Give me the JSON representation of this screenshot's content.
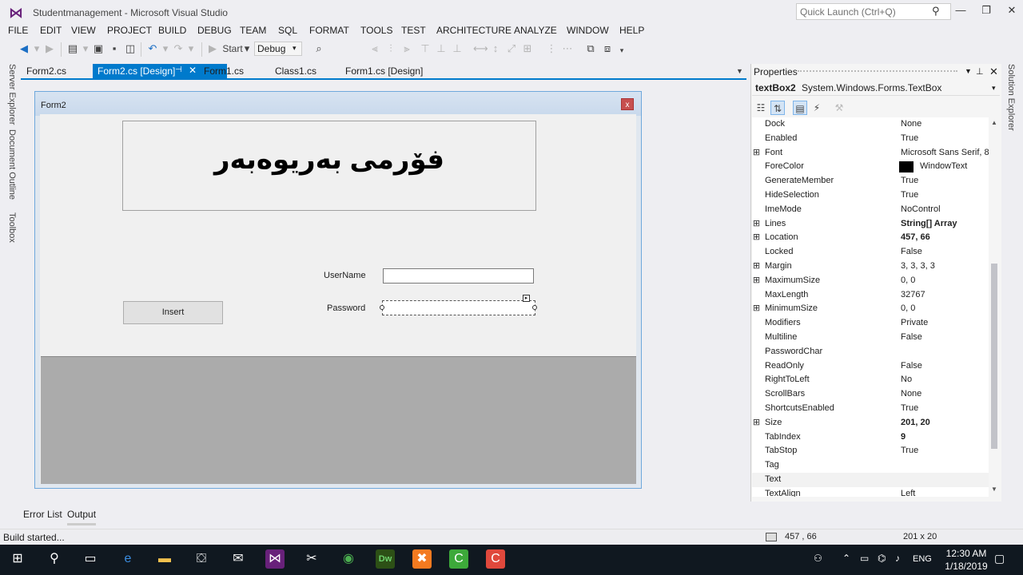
{
  "window": {
    "title": "Studentmanagement - Microsoft Visual Studio",
    "quick_launch_placeholder": "Quick Launch (Ctrl+Q)",
    "minimize": "—",
    "restore": "❐",
    "close": "✕"
  },
  "menu": [
    "FILE",
    "EDIT",
    "VIEW",
    "PROJECT",
    "BUILD",
    "DEBUG",
    "TEAM",
    "SQL",
    "FORMAT",
    "TOOLS",
    "TEST",
    "ARCHITECTURE",
    "ANALYZE",
    "WINDOW",
    "HELP"
  ],
  "toolbar": {
    "start_label": "Start",
    "config_value": "Debug"
  },
  "side_tabs": {
    "server_explorer": "Server Explorer",
    "document_outline": "Document Outline",
    "toolbox": "Toolbox",
    "solution_explorer": "Solution Explorer"
  },
  "doc_tabs": [
    "Form2.cs",
    "Form2.cs [Design]",
    "Form1.cs",
    "Class1.cs",
    "Form1.cs [Design]"
  ],
  "form": {
    "title": "Form2",
    "close_glyph": "x",
    "header_text": "فۆرمی بەریوەبەر",
    "username_label": "UserName",
    "password_label": "Password",
    "insert_label": "Insert"
  },
  "bottom_tabs": [
    "Error List",
    "Output"
  ],
  "properties": {
    "title": "Properties",
    "object_name": "textBox2",
    "object_type": "System.Windows.Forms.TextBox",
    "rows": [
      {
        "name": "Dock",
        "value": "None",
        "expandable": false,
        "bold": false
      },
      {
        "name": "Enabled",
        "value": "True",
        "expandable": false,
        "bold": false
      },
      {
        "name": "Font",
        "value": "Microsoft Sans Serif, 8",
        "expandable": true,
        "bold": false
      },
      {
        "name": "ForeColor",
        "value": "WindowText",
        "expandable": false,
        "bold": false
      },
      {
        "name": "GenerateMember",
        "value": "True",
        "expandable": false,
        "bold": false
      },
      {
        "name": "HideSelection",
        "value": "True",
        "expandable": false,
        "bold": false
      },
      {
        "name": "ImeMode",
        "value": "NoControl",
        "expandable": false,
        "bold": false
      },
      {
        "name": "Lines",
        "value": "String[] Array",
        "expandable": true,
        "bold": true
      },
      {
        "name": "Location",
        "value": "457, 66",
        "expandable": true,
        "bold": true
      },
      {
        "name": "Locked",
        "value": "False",
        "expandable": false,
        "bold": false
      },
      {
        "name": "Margin",
        "value": "3, 3, 3, 3",
        "expandable": true,
        "bold": false
      },
      {
        "name": "MaximumSize",
        "value": "0, 0",
        "expandable": true,
        "bold": false
      },
      {
        "name": "MaxLength",
        "value": "32767",
        "expandable": false,
        "bold": false
      },
      {
        "name": "MinimumSize",
        "value": "0, 0",
        "expandable": true,
        "bold": false
      },
      {
        "name": "Modifiers",
        "value": "Private",
        "expandable": false,
        "bold": false
      },
      {
        "name": "Multiline",
        "value": "False",
        "expandable": false,
        "bold": false
      },
      {
        "name": "PasswordChar",
        "value": "",
        "expandable": false,
        "bold": false
      },
      {
        "name": "ReadOnly",
        "value": "False",
        "expandable": false,
        "bold": false
      },
      {
        "name": "RightToLeft",
        "value": "No",
        "expandable": false,
        "bold": false
      },
      {
        "name": "ScrollBars",
        "value": "None",
        "expandable": false,
        "bold": false
      },
      {
        "name": "ShortcutsEnabled",
        "value": "True",
        "expandable": false,
        "bold": false
      },
      {
        "name": "Size",
        "value": "201, 20",
        "expandable": true,
        "bold": true
      },
      {
        "name": "TabIndex",
        "value": "9",
        "expandable": false,
        "bold": true
      },
      {
        "name": "TabStop",
        "value": "True",
        "expandable": false,
        "bold": false
      },
      {
        "name": "Tag",
        "value": "",
        "expandable": false,
        "bold": false
      },
      {
        "name": "Text",
        "value": "",
        "expandable": false,
        "bold": false
      },
      {
        "name": "TextAlign",
        "value": "Left",
        "expandable": false,
        "bold": false
      }
    ]
  },
  "status": {
    "text": "Build started...",
    "location": "457 , 66",
    "size": "201 x 20"
  },
  "taskbar": {
    "time": "12:30 AM",
    "date": "1/18/2019",
    "lang": "ENG"
  },
  "colors": {
    "accent": "#007acc",
    "vs_purple": "#68217a"
  }
}
